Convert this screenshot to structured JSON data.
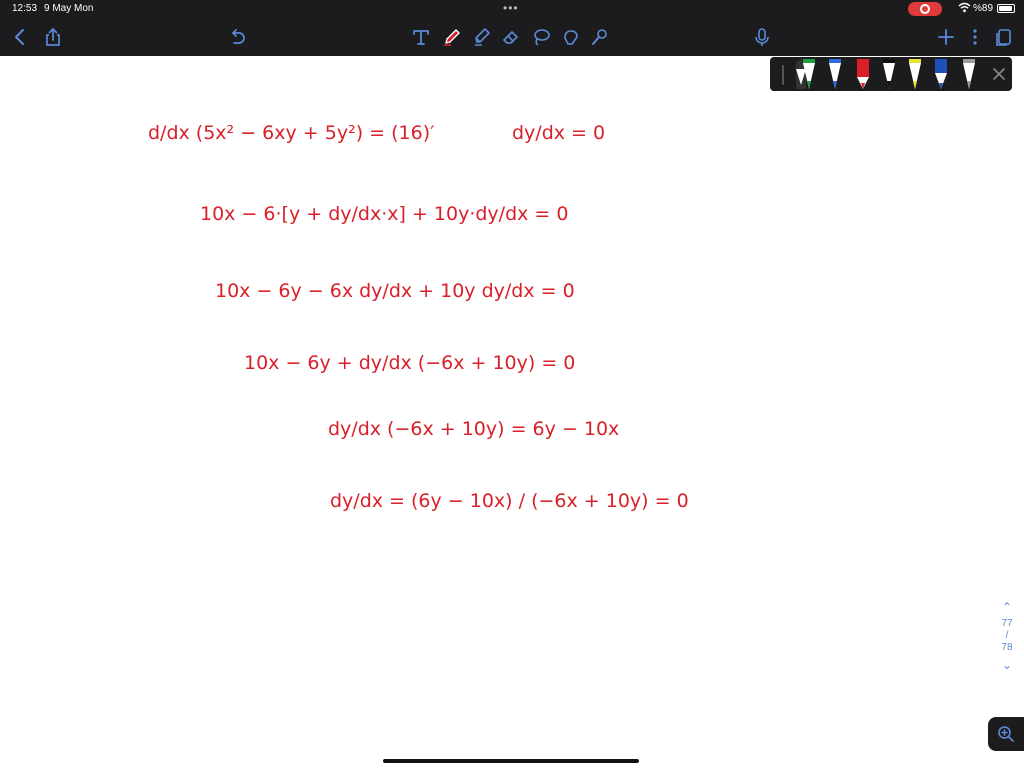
{
  "status_bar": {
    "time": "12:53",
    "date": "9 May Mon",
    "battery": "%89"
  },
  "colors": {
    "toolbar_bg": "#1c1c1e",
    "accent": "#5a8ad6",
    "ink": "#d9202a",
    "record": "#e03a3a"
  },
  "toolbar": {
    "left": [
      "back-icon",
      "share-icon",
      "undo-icon"
    ],
    "tools": [
      "text-tool-icon",
      "pen-tool-icon",
      "highlighter-tool-icon",
      "eraser-tool-icon",
      "lasso-tool-icon",
      "shape-tool-icon",
      "laser-pointer-icon"
    ],
    "right": [
      "microphone-icon",
      "add-icon",
      "more-icon",
      "pages-icon"
    ]
  },
  "pen_palette": {
    "pens": [
      {
        "color": "#ffffff"
      },
      {
        "color": "#1f9d3a"
      },
      {
        "color": "#2d6bd8"
      },
      {
        "color": "#d9202a"
      },
      {
        "color": "#111111"
      },
      {
        "color": "#e9e23a"
      },
      {
        "color": "#1f4fb8"
      },
      {
        "color": "#9a9a9a"
      }
    ]
  },
  "page_nav": {
    "current": "77",
    "separator": "/",
    "total": "78"
  },
  "handwriting": {
    "line1": "d/dx (5x² − 6xy + 5y²) = (16)′",
    "line1_right": "dy/dx = 0",
    "line2": "10x − 6·[y + dy/dx·x] + 10y·dy/dx = 0",
    "line3": "10x − 6y − 6x dy/dx + 10y dy/dx = 0",
    "line4": "10x − 6y + dy/dx (−6x + 10y) = 0",
    "line5": "dy/dx (−6x + 10y) = 6y − 10x",
    "line6": "dy/dx = (6y − 10x) / (−6x + 10y) = 0"
  }
}
